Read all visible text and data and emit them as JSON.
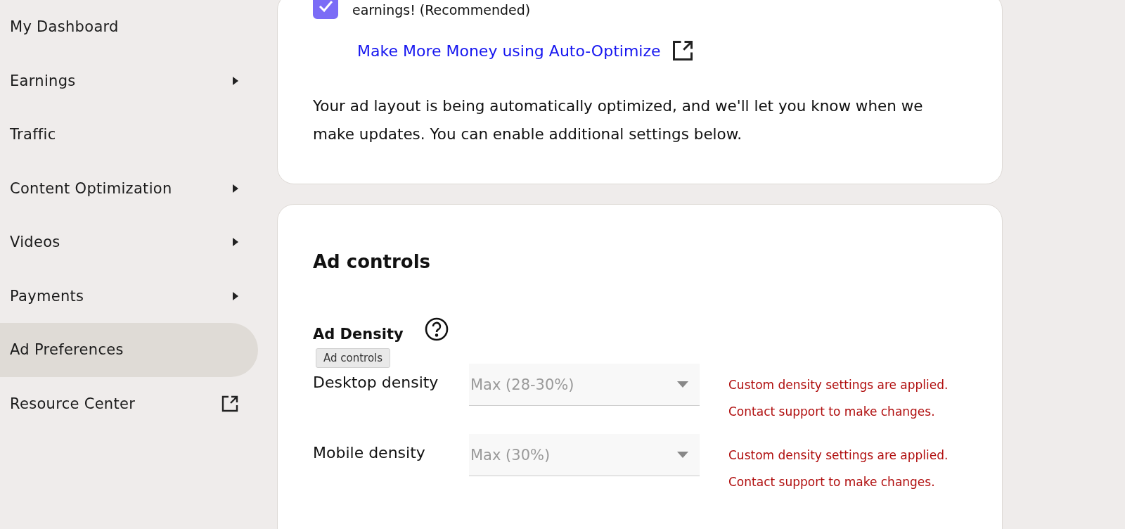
{
  "sidebar": {
    "items": [
      {
        "label": "My Dashboard",
        "kind": "plain",
        "selected": false
      },
      {
        "label": "Earnings",
        "kind": "submenu",
        "selected": false
      },
      {
        "label": "Traffic",
        "kind": "plain",
        "selected": false
      },
      {
        "label": "Content Optimization",
        "kind": "submenu",
        "selected": false
      },
      {
        "label": "Videos",
        "kind": "submenu",
        "selected": false
      },
      {
        "label": "Payments",
        "kind": "submenu",
        "selected": false
      },
      {
        "label": "Ad Preferences",
        "kind": "plain",
        "selected": true
      },
      {
        "label": "Resource Center",
        "kind": "external",
        "selected": false
      }
    ]
  },
  "auto_optimize": {
    "checked": true,
    "label": "earnings! (Recommended)",
    "link": "Make More Money using Auto-Optimize",
    "description": "Your ad layout is being automatically optimized, and we'll let you know when we make updates. You can enable additional settings below."
  },
  "ad_controls": {
    "title": "Ad controls",
    "density_title": "Ad Density",
    "tooltip": "Ad controls",
    "rows": [
      {
        "label": "Desktop density",
        "value": "Max (28-30%)",
        "disabled": true,
        "notes": [
          "Custom density settings are applied.",
          "Contact support to make changes."
        ]
      },
      {
        "label": "Mobile density",
        "value": "Max (30%)",
        "disabled": true,
        "notes": [
          "Custom density settings are applied.",
          "Contact support to make changes."
        ]
      }
    ]
  }
}
